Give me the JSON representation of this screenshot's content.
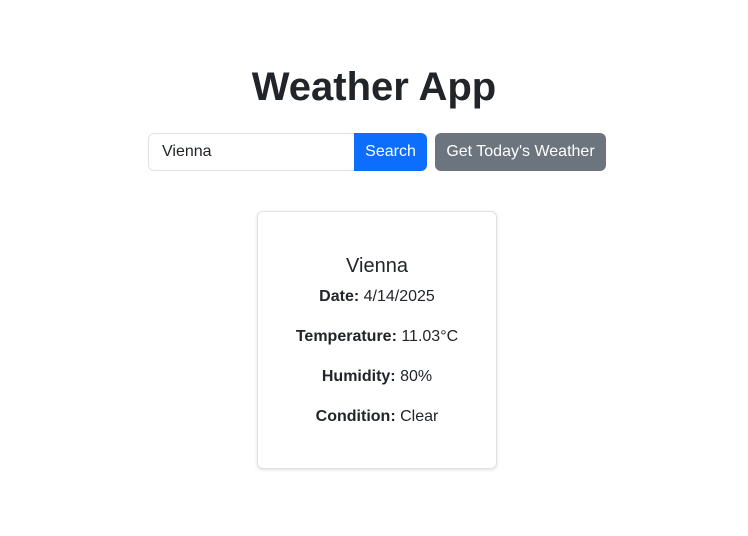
{
  "header": {
    "title": "Weather App"
  },
  "search": {
    "value": "Vienna",
    "search_label": "Search",
    "today_label": "Get Today's Weather"
  },
  "card": {
    "city": "Vienna",
    "date_label": "Date:",
    "date_value": "4/14/2025",
    "temperature_label": "Temperature:",
    "temperature_value": "11.03°C",
    "humidity_label": "Humidity:",
    "humidity_value": "80%",
    "condition_label": "Condition:",
    "condition_value": "Clear"
  },
  "colors": {
    "primary": "#0d6efd",
    "secondary": "#6c757d",
    "text": "#212529",
    "border": "#dee2e6"
  }
}
